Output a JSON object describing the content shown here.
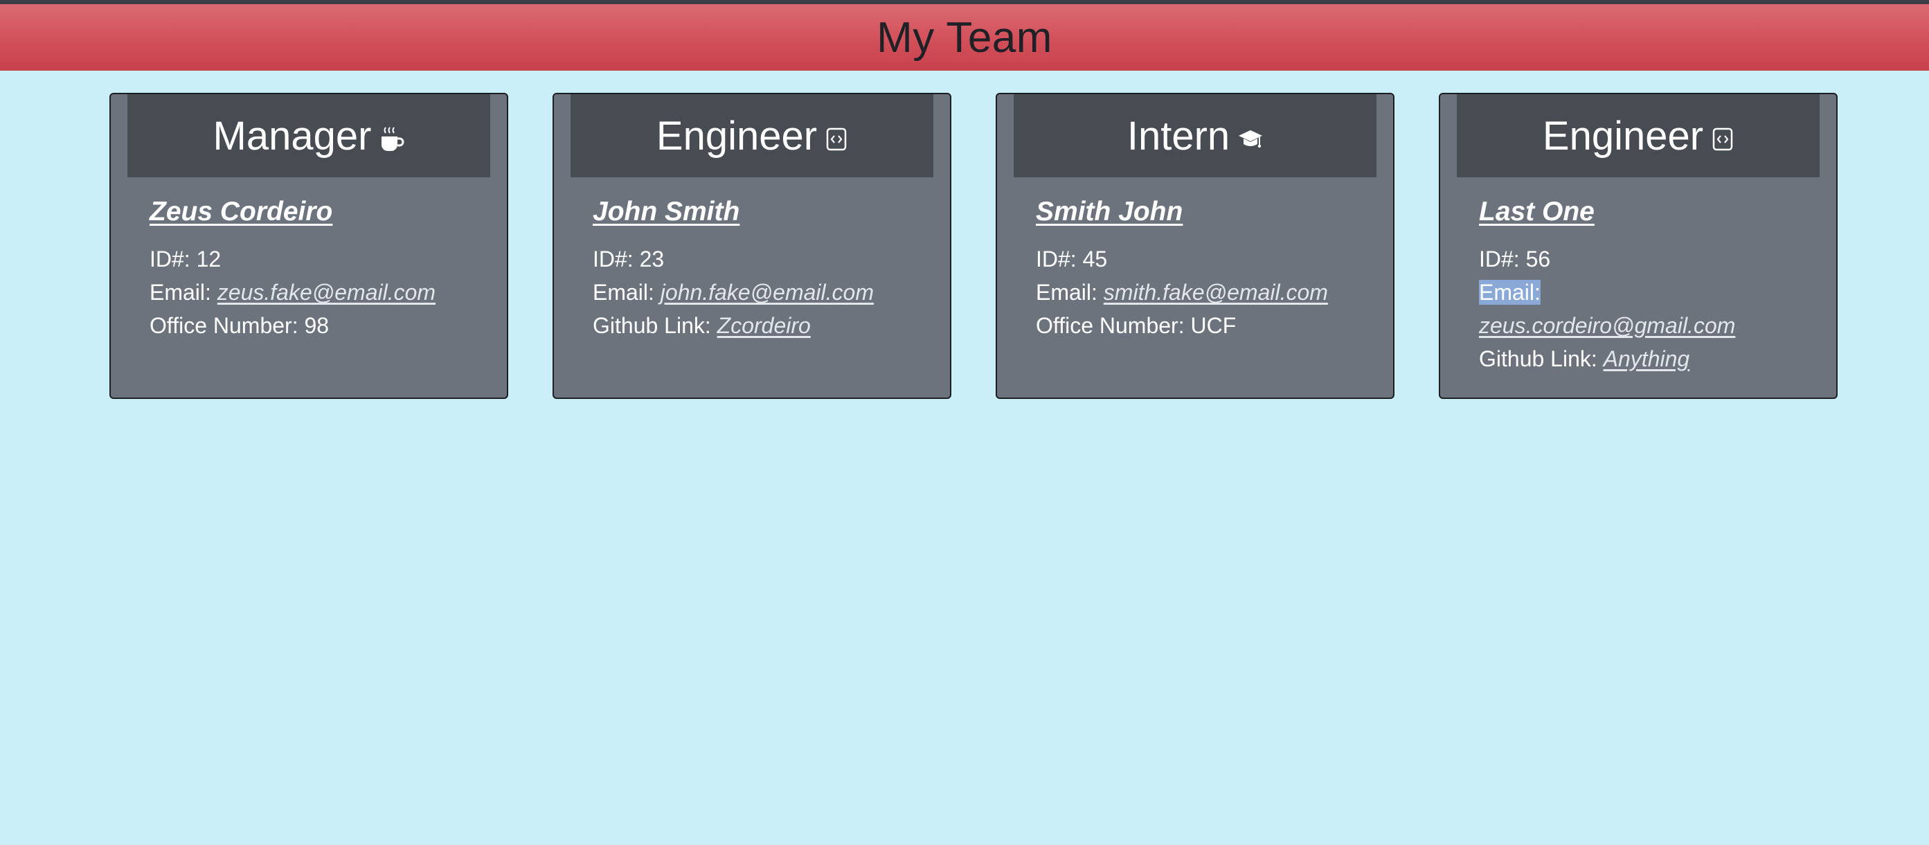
{
  "header": {
    "title": "My Team"
  },
  "cards": [
    {
      "role": "Manager",
      "icon": "coffee-mug-icon",
      "name": "Zeus Cordeiro",
      "id_label": "ID#: 12",
      "email_label": "Email: ",
      "email": "zeus.fake@email.com",
      "extra_label": "Office Number: 98"
    },
    {
      "role": "Engineer",
      "icon": "code-file-icon",
      "name": "John Smith",
      "id_label": "ID#: 23",
      "email_label": "Email: ",
      "email": "john.fake@email.com",
      "extra_label": "Github Link: ",
      "extra_link": "Zcordeiro"
    },
    {
      "role": "Intern",
      "icon": "graduation-cap-icon",
      "name": "Smith John",
      "id_label": "ID#: 45",
      "email_label": "Email: ",
      "email": "smith.fake@email.com",
      "extra_label": "Office Number: UCF"
    },
    {
      "role": "Engineer",
      "icon": "code-file-icon",
      "name": "Last One",
      "id_label": "ID#: 56",
      "email_label": "Email:",
      "email": "zeus.cordeiro@gmail.com",
      "extra_label": "Github Link: ",
      "extra_link": "Anything"
    }
  ]
}
